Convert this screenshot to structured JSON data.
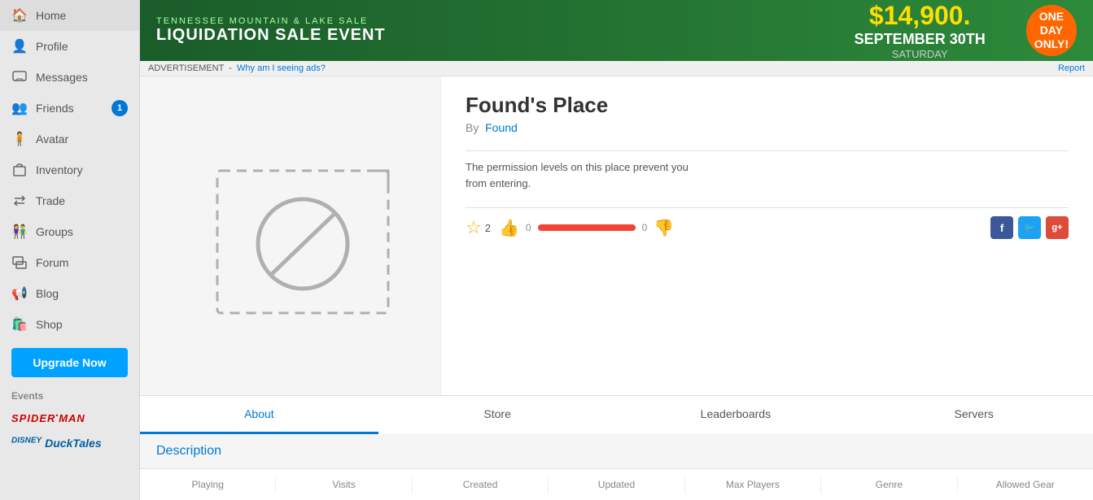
{
  "sidebar": {
    "items": [
      {
        "id": "home",
        "label": "Home",
        "icon": "🏠"
      },
      {
        "id": "profile",
        "label": "Profile",
        "icon": "👤"
      },
      {
        "id": "messages",
        "label": "Messages",
        "icon": "💬"
      },
      {
        "id": "friends",
        "label": "Friends",
        "icon": "👥",
        "badge": "1"
      },
      {
        "id": "avatar",
        "label": "Avatar",
        "icon": "🧍"
      },
      {
        "id": "inventory",
        "label": "Inventory",
        "icon": "🎒"
      },
      {
        "id": "trade",
        "label": "Trade",
        "icon": "🔄"
      },
      {
        "id": "groups",
        "label": "Groups",
        "icon": "👫"
      },
      {
        "id": "forum",
        "label": "Forum",
        "icon": "📋"
      },
      {
        "id": "blog",
        "label": "Blog",
        "icon": "📢"
      },
      {
        "id": "shop",
        "label": "Shop",
        "icon": "🛍️"
      }
    ],
    "upgrade_label": "Upgrade Now",
    "events_label": "Events"
  },
  "ad": {
    "price": "$14,900.",
    "subtitle": "TENNESSEE MOUNTAIN & LAKE SALE",
    "title": "LIQUIDATION SALE EVENT",
    "date": "SEPTEMBER 30TH",
    "day": "SATURDAY",
    "badge": "ONE\nDAY\nONLY!",
    "footer_label": "ADVERTISEMENT",
    "footer_why": "Why am I seeing ads?",
    "report": "Report"
  },
  "place": {
    "title": "Found's Place",
    "by_label": "By",
    "author": "Found",
    "permission_text": "The permission levels on this place prevent you from entering.",
    "star_count": "2",
    "thumb_up_count": "0",
    "thumb_down_count": "0"
  },
  "tabs": [
    {
      "id": "about",
      "label": "About",
      "active": true
    },
    {
      "id": "store",
      "label": "Store",
      "active": false
    },
    {
      "id": "leaderboards",
      "label": "Leaderboards",
      "active": false
    },
    {
      "id": "servers",
      "label": "Servers",
      "active": false
    }
  ],
  "description": {
    "title": "Description"
  },
  "stats": {
    "columns": [
      "Playing",
      "Visits",
      "Created",
      "Updated",
      "Max Players",
      "Genre",
      "Allowed Gear"
    ]
  },
  "events": [
    {
      "id": "spiderman",
      "label": "SPIDER-MAN"
    },
    {
      "id": "ducktales",
      "label": "DuckTales"
    }
  ]
}
